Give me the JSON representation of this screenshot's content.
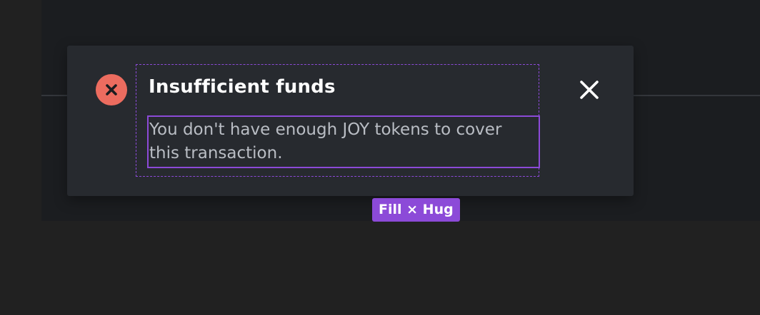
{
  "toast": {
    "title": "Insufficient funds",
    "message": "You don't have enough JOY tokens to cover this transaction.",
    "status_icon": "error-circle-x-icon",
    "close_icon": "close-icon"
  },
  "inspector": {
    "sizing_badge": "Fill × Hug"
  },
  "colors": {
    "background": "#212121",
    "frame": "#1b1d20",
    "toast_surface": "#272a2f",
    "error_red": "#ec6c5f",
    "selection_purple": "#8c4ad8",
    "title_text": "#ffffff",
    "body_text": "#b9bdc4"
  }
}
